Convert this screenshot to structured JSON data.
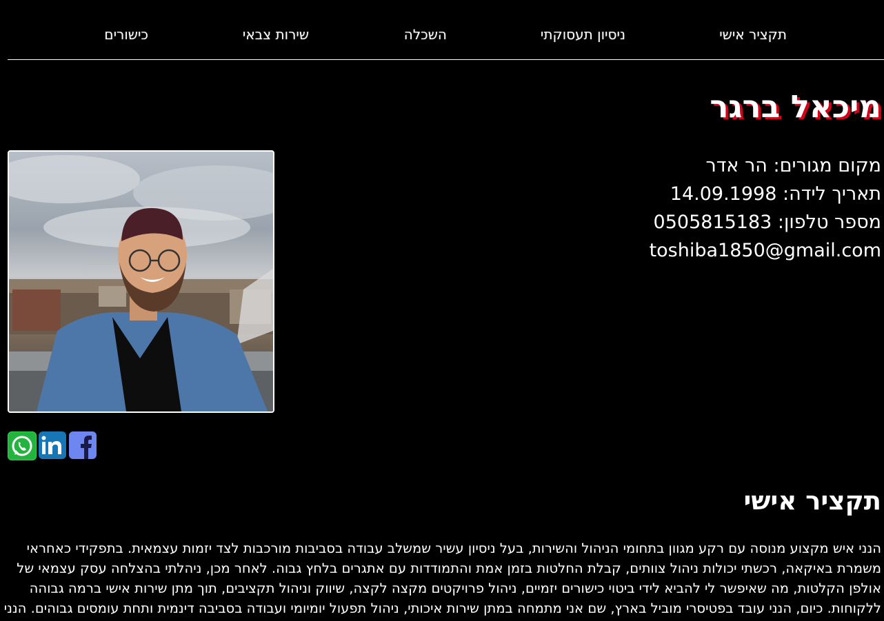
{
  "nav": {
    "items": [
      {
        "label": "תקציר אישי"
      },
      {
        "label": "ניסיון תעסוקתי"
      },
      {
        "label": "השכלה"
      },
      {
        "label": "שירות צבאי"
      },
      {
        "label": "כישורים"
      }
    ]
  },
  "profile": {
    "name": "מיכאל ברגר",
    "residence": "מקום מגורים: הר אדר",
    "birth_date": "תאריך לידה: 14.09.1998",
    "phone": "מספר טלפון: 0505815183",
    "email": "toshiba1850@gmail.com",
    "name_shadow_color": "#d3001a"
  },
  "social": {
    "icons": [
      "whatsapp-icon",
      "linkedin-icon",
      "facebook-icon"
    ]
  },
  "summary": {
    "title": "תקציר אישי",
    "lines": [
      "הנני איש מקצוע מנוסה עם רקע מגוון בתחומי הניהול והשירות, בעל ניסיון עשיר שמשלב עבודה בסביבות מורכבות לצד יזמות עצמאית. בתפקידי כאחראי",
      "משמרת באיקאה, רכשתי יכולות ניהול צוותים, קבלת החלטות בזמן אמת והתמודדות עם אתגרים בלחץ גבוה. לאחר מכן, ניהלתי בהצלחה עסק עצמאי של",
      "אולפן הקלטות, מה שאיפשר לי להביא לידי ביטוי כישורים יזמיים, ניהול פרויקטים מקצה לקצה, שיווק וניהול תקציבים, תוך מתן שירות אישי ברמה גבוהה",
      "ללקוחות. כיום, הנני עובד בפטיסרי מוביל בארץ, שם אני מתמחה במתן שירות איכותי, ניהול תפעול יומיומי ועבודה בסביבה דינמית ותחת עומסים גבוהים. הנני"
    ]
  }
}
